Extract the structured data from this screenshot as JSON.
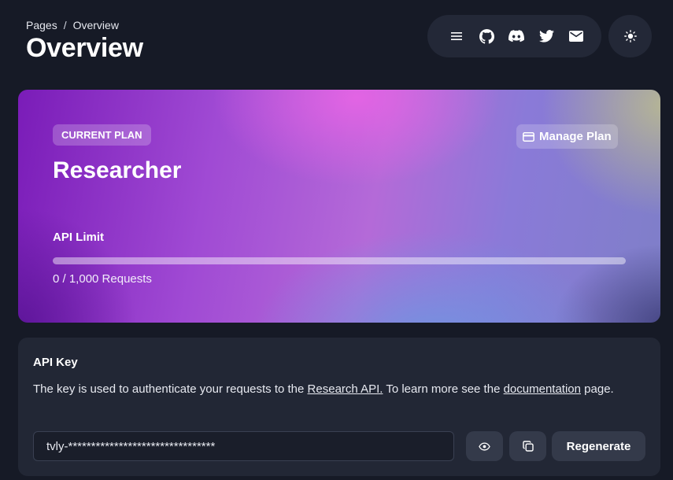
{
  "breadcrumb": {
    "root": "Pages",
    "separator": "/",
    "current": "Overview"
  },
  "page": {
    "title": "Overview"
  },
  "header_icons": [
    "menu-icon",
    "github-icon",
    "discord-icon",
    "twitter-icon",
    "mail-icon"
  ],
  "theme_toggle_icon": "sun-icon",
  "plan": {
    "badge": "CURRENT PLAN",
    "name": "Researcher",
    "manage_label": "Manage Plan",
    "limit_label": "API Limit",
    "usage_text": "0 / 1,000 Requests",
    "used": 0,
    "limit": 1000
  },
  "api_key": {
    "title": "API Key",
    "desc_before": "The key is used to authenticate your requests to the ",
    "link_research_api": "Research API.",
    "desc_middle": " To learn more see the ",
    "link_documentation": "documentation",
    "desc_after": " page.",
    "value": "tvly-********************************",
    "regenerate_label": "Regenerate"
  },
  "colors": {
    "background": "#161a26",
    "card": "#222735",
    "pill": "#232837",
    "plan_gradient_start": "#7a1cb8",
    "plan_gradient_mid": "#b46ad8"
  }
}
